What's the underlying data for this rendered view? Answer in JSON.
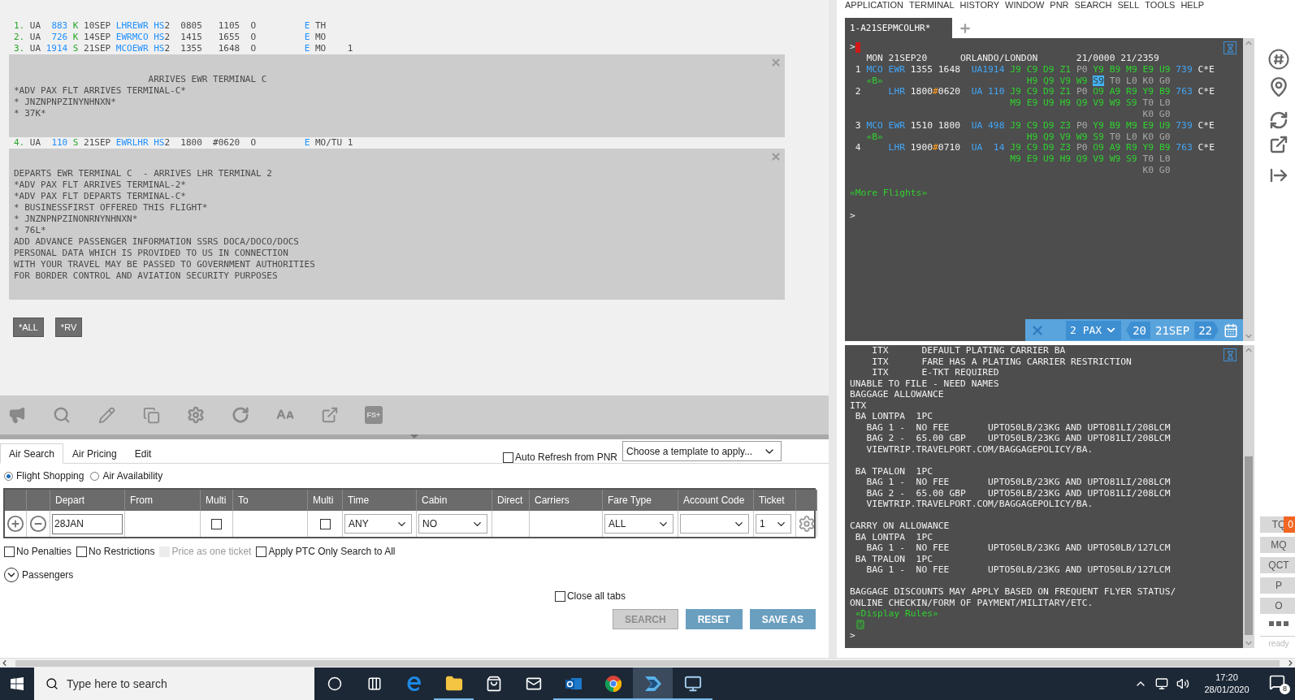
{
  "left_terminal": {
    "blocks": [
      {
        "kind": "lines",
        "lines": [
          [
            {
              "kind": "index",
              "text": "1."
            },
            {
              "kind": "plain",
              "text": " UA  "
            },
            {
              "kind": "code",
              "text": "883"
            },
            {
              "kind": "class",
              "text": " K"
            },
            {
              "kind": "plain",
              "text": " 10SEP "
            },
            {
              "kind": "code",
              "text": "LHREWR HS"
            },
            {
              "kind": "plain",
              "text": "2  0805   1105  O         "
            },
            {
              "kind": "code",
              "text": "E"
            },
            {
              "kind": "plain",
              "text": " TH"
            }
          ],
          [
            {
              "kind": "index",
              "text": "2."
            },
            {
              "kind": "plain",
              "text": " UA  "
            },
            {
              "kind": "code",
              "text": "726"
            },
            {
              "kind": "class",
              "text": " K"
            },
            {
              "kind": "plain",
              "text": " 14SEP "
            },
            {
              "kind": "code",
              "text": "EWRMCO HS"
            },
            {
              "kind": "plain",
              "text": "2  1415   1655  O         "
            },
            {
              "kind": "code",
              "text": "E"
            },
            {
              "kind": "plain",
              "text": " MO"
            }
          ],
          [
            {
              "kind": "index",
              "text": "3."
            },
            {
              "kind": "plain",
              "text": " UA "
            },
            {
              "kind": "code",
              "text": "1914"
            },
            {
              "kind": "class",
              "text": " S"
            },
            {
              "kind": "plain",
              "text": " 21SEP "
            },
            {
              "kind": "code",
              "text": "MCOEWR HS"
            },
            {
              "kind": "plain",
              "text": "2  1355   1648  O         "
            },
            {
              "kind": "code",
              "text": "E"
            },
            {
              "kind": "plain",
              "text": " MO    1"
            }
          ]
        ]
      },
      {
        "kind": "note",
        "lines": [
          "                         ARRIVES EWR TERMINAL C",
          "*ADV PAX FLT ARRIVES TERMINAL-C*",
          "* JNZNPNPZINYNHNXN*",
          "* 37K*"
        ]
      },
      {
        "kind": "lines",
        "lines": [
          [
            {
              "kind": "index",
              "text": "4."
            },
            {
              "kind": "plain",
              "text": " UA  "
            },
            {
              "kind": "code",
              "text": "110"
            },
            {
              "kind": "class",
              "text": " S"
            },
            {
              "kind": "plain",
              "text": " 21SEP "
            },
            {
              "kind": "code",
              "text": "EWRLHR HS"
            },
            {
              "kind": "plain",
              "text": "2  1800  #0620  O         "
            },
            {
              "kind": "code",
              "text": "E"
            },
            {
              "kind": "plain",
              "text": " MO/TU 1"
            }
          ]
        ]
      },
      {
        "kind": "note",
        "lines": [
          "DEPARTS EWR TERMINAL C  - ARRIVES LHR TERMINAL 2",
          "*ADV PAX FLT ARRIVES TERMINAL-2*",
          "*ADV PAX FLT DEPARTS TERMINAL-C*",
          "* BUSINESSFIRST OFFERED THIS FLIGHT*",
          "* JNZNPNPZINONRNYNHNXN*",
          "* 76L*",
          "ADD ADVANCE PASSENGER INFORMATION SSRS DOCA/DOCO/DOCS",
          "PERSONAL DATA WHICH IS PROVIDED TO US IN CONNECTION",
          "WITH YOUR TRAVEL MAY BE PASSED TO GOVERNMENT AUTHORITIES",
          "FOR BORDER CONTROL AND AVIATION SECURITY PURPOSES"
        ]
      }
    ],
    "commands": [
      "*ALL",
      "*RV"
    ]
  },
  "toolbar": {
    "badge_label": "FS+"
  },
  "form": {
    "tabs": [
      {
        "label": "Air Search",
        "selected": true
      },
      {
        "label": "Air Pricing",
        "selected": false
      },
      {
        "label": "Edit",
        "selected": false
      }
    ],
    "auto_refresh": {
      "label": "Auto Refresh from PNR",
      "checked": false
    },
    "template": {
      "placeholder": "Choose a template to apply..."
    },
    "modes": [
      {
        "label": "Flight Shopping",
        "selected": true
      },
      {
        "label": "Air Availability",
        "selected": false
      }
    ],
    "table": {
      "columns": [
        {
          "kind": "add"
        },
        {
          "kind": "remove"
        },
        {
          "label": "Depart",
          "kind": "input",
          "value": "28JAN"
        },
        {
          "label": "From",
          "kind": "empty"
        },
        {
          "label": "Multi",
          "kind": "check",
          "checked": false
        },
        {
          "label": "To",
          "kind": "empty"
        },
        {
          "label": "Multi",
          "kind": "check",
          "checked": false
        },
        {
          "label": "Time",
          "kind": "select",
          "value": "ANY"
        },
        {
          "label": "Cabin",
          "kind": "select",
          "value": "NO"
        },
        {
          "label": "Direct",
          "kind": "empty"
        },
        {
          "label": "Carriers",
          "kind": "empty"
        },
        {
          "label": "Fare Type",
          "kind": "select",
          "value": "ALL"
        },
        {
          "label": "Account Code",
          "kind": "select"
        },
        {
          "label": "Ticket",
          "kind": "select",
          "value": "1"
        },
        {
          "kind": "gear"
        }
      ]
    },
    "options": [
      {
        "label": "No Penalties",
        "checked": false,
        "disabled": false
      },
      {
        "label": "No Restrictions",
        "checked": false,
        "disabled": false
      },
      {
        "label": "Price as one ticket",
        "checked": false,
        "disabled": true
      },
      {
        "label": "Apply PTC Only Search to All",
        "checked": false,
        "disabled": false
      }
    ],
    "passengers": {
      "label": "Passengers",
      "expanded": false
    },
    "close_all_tabs": {
      "label": "Close all tabs",
      "checked": false
    },
    "buttons": [
      {
        "label": "SEARCH",
        "disabled": true
      },
      {
        "label": "RESET",
        "disabled": false
      },
      {
        "label": "SAVE AS",
        "disabled": false
      }
    ]
  },
  "menu": [
    "APPLICATION",
    "TERMINAL",
    "HISTORY",
    "WINDOW",
    "PNR",
    "SEARCH",
    "SELL",
    "TOOLS",
    "HELP"
  ],
  "terminal_tab": {
    "label": "1-A21SEPMCOLHR*",
    "selected": true
  },
  "terminal_top": {
    "prompt": ">",
    "cursor": true,
    "blocks": [
      [
        [
          {
            "kind": "plain",
            "text": "   MON 21SEP20      ORLANDO/LONDON       21/0000 21/2359"
          }
        ],
        [
          {
            "kind": "plain",
            "text": " 1 "
          },
          {
            "kind": "city",
            "text": "MCO EWR"
          },
          {
            "kind": "plain",
            "text": " 1355 1648  "
          },
          {
            "kind": "city",
            "text": "UA1914 "
          },
          {
            "kind": "avail",
            "text": "J9 C9 D9 Z1 "
          },
          {
            "kind": "zero",
            "text": "P0 "
          },
          {
            "kind": "avail",
            "text": "Y9 B9 M9 E9 U9 "
          },
          {
            "kind": "city",
            "text": "739"
          },
          {
            "kind": "plain",
            "text": " C*E"
          }
        ],
        [
          {
            "kind": "link",
            "text": "   «B»"
          },
          {
            "kind": "avail",
            "text": "                          H9 Q9 V9 W9 "
          },
          {
            "kind": "sel",
            "text": "S9"
          },
          {
            "kind": "zero",
            "text": " T0 L0 K0 G0"
          }
        ],
        [
          {
            "kind": "plain",
            "text": " 2     "
          },
          {
            "kind": "city",
            "text": "LHR"
          },
          {
            "kind": "plain",
            "text": " 1800"
          },
          {
            "kind": "hash",
            "text": "#"
          },
          {
            "kind": "plain",
            "text": "0620  "
          },
          {
            "kind": "city",
            "text": "UA 110 "
          },
          {
            "kind": "avail",
            "text": "J9 C9 D9 Z1 "
          },
          {
            "kind": "zero",
            "text": "P0 "
          },
          {
            "kind": "avail",
            "text": "O9 A9 R9 Y9 B9 "
          },
          {
            "kind": "city",
            "text": "763"
          },
          {
            "kind": "plain",
            "text": " C*E"
          }
        ],
        [
          {
            "kind": "avail",
            "text": "                             M9 E9 U9 H9 Q9 V9 W9 S9 "
          },
          {
            "kind": "zero",
            "text": "T0 L0"
          }
        ],
        [
          {
            "kind": "zero",
            "text": "                                                     K0 G0"
          }
        ],
        [
          {
            "kind": "plain",
            "text": " 3 "
          },
          {
            "kind": "city",
            "text": "MCO EWR"
          },
          {
            "kind": "plain",
            "text": " 1510 1800  "
          },
          {
            "kind": "city",
            "text": "UA 498 "
          },
          {
            "kind": "avail",
            "text": "J9 C9 D9 Z3 "
          },
          {
            "kind": "zero",
            "text": "P0 "
          },
          {
            "kind": "avail",
            "text": "Y9 B9 M9 E9 U9 "
          },
          {
            "kind": "city",
            "text": "739"
          },
          {
            "kind": "plain",
            "text": " C*E"
          }
        ],
        [
          {
            "kind": "link",
            "text": "   «B»"
          },
          {
            "kind": "avail",
            "text": "                          H9 Q9 V9 W9 S9 "
          },
          {
            "kind": "zero",
            "text": "T0 L0 K0 G0"
          }
        ],
        [
          {
            "kind": "plain",
            "text": " 4     "
          },
          {
            "kind": "city",
            "text": "LHR"
          },
          {
            "kind": "plain",
            "text": " 1900"
          },
          {
            "kind": "hash",
            "text": "#"
          },
          {
            "kind": "plain",
            "text": "0710  "
          },
          {
            "kind": "city",
            "text": "UA  14 "
          },
          {
            "kind": "avail",
            "text": "J9 C9 D9 Z3 "
          },
          {
            "kind": "zero",
            "text": "P0 "
          },
          {
            "kind": "avail",
            "text": "O9 A9 R9 Y9 B9 "
          },
          {
            "kind": "city",
            "text": "763"
          },
          {
            "kind": "plain",
            "text": " C*E"
          }
        ],
        [
          {
            "kind": "avail",
            "text": "                             M9 E9 U9 H9 Q9 V9 W9 S9 "
          },
          {
            "kind": "zero",
            "text": "T0 L0"
          }
        ],
        [
          {
            "kind": "zero",
            "text": "                                                     K0 G0"
          }
        ]
      ],
      [
        [
          {
            "kind": "link",
            "text": "«More Flights»"
          }
        ]
      ]
    ],
    "end_prompt": ">",
    "bar": {
      "pax": "2 PAX",
      "prev": "20",
      "date": "21SEP",
      "next": "22"
    }
  },
  "terminal_bottom": {
    "blocks": [
      [
        "    ITX      DEFAULT PLATING CARRIER BA",
        "    ITX      FARE HAS A PLATING CARRIER RESTRICTION",
        "    ITX      E-TKT REQUIRED",
        "UNABLE TO FILE - NEED NAMES",
        "BAGGAGE ALLOWANCE",
        "ITX",
        " BA LONTPA  1PC",
        "   BAG 1 -  NO FEE       UPTO50LB/23KG AND UPTO81LI/208LCM",
        "   BAG 2 -  65.00 GBP    UPTO50LB/23KG AND UPTO81LI/208LCM",
        "   VIEWTRIP.TRAVELPORT.COM/BAGGAGEPOLICY/BA."
      ],
      [
        " BA TPALON  1PC",
        "   BAG 1 -  NO FEE       UPTO50LB/23KG AND UPTO81LI/208LCM",
        "   BAG 2 -  65.00 GBP    UPTO50LB/23KG AND UPTO81LI/208LCM",
        "   VIEWTRIP.TRAVELPORT.COM/BAGGAGEPOLICY/BA."
      ],
      [
        "CARRY ON ALLOWANCE",
        " BA LONTPA  1PC",
        "   BAG 1 -  NO FEE       UPTO50LB/23KG AND UPTO50LB/127LCM",
        " BA TPALON  1PC",
        "   BAG 1 -  NO FEE       UPTO50LB/23KG AND UPTO50LB/127LCM"
      ],
      [
        "BAGGAGE DISCOUNTS MAY APPLY BASED ON FREQUENT FLYER STATUS/",
        "ONLINE CHECKIN/FORM OF PAYMENT/MILITARY/ETC."
      ]
    ],
    "link": "«Display Rules»",
    "end_prompt": ">"
  },
  "quick_buttons": [
    {
      "label": "TQ",
      "count": "0"
    },
    {
      "label": "MQ"
    },
    {
      "label": "QCT"
    },
    {
      "label": "P"
    },
    {
      "label": "O"
    }
  ],
  "status": "ready",
  "taskbar": {
    "search": {
      "placeholder": "Type here to search"
    },
    "apps": [
      {
        "running": false,
        "selected": false
      },
      {
        "running": false,
        "selected": false
      },
      {
        "running": false,
        "selected": false
      },
      {
        "running": true,
        "selected": false
      },
      {
        "running": false,
        "selected": false
      },
      {
        "running": false,
        "selected": false
      },
      {
        "running": true,
        "selected": false
      },
      {
        "running": true,
        "selected": false
      },
      {
        "running": true,
        "selected": true
      },
      {
        "running": true,
        "selected": false
      }
    ],
    "time": "17:20",
    "date": "28/01/2020",
    "notifications": "8"
  }
}
